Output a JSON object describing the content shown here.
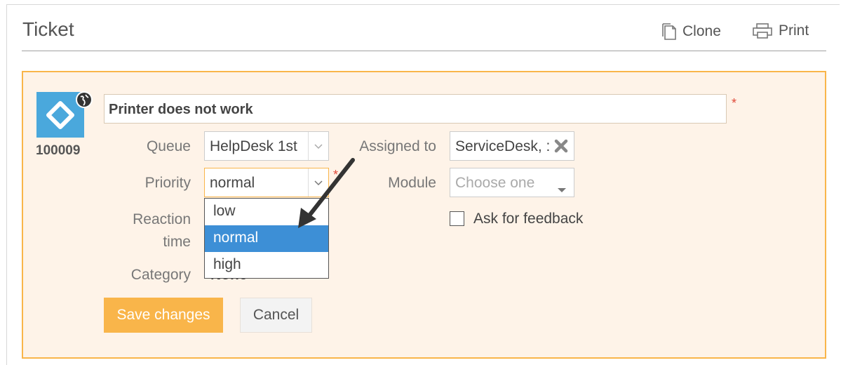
{
  "header": {
    "title": "Ticket",
    "clone_label": "Clone",
    "print_label": "Print"
  },
  "ticket": {
    "id": "100009",
    "subject": "Printer does not work"
  },
  "fields": {
    "queue_label": "Queue",
    "queue_value": "HelpDesk 1st",
    "assigned_label": "Assigned to",
    "assigned_value": "ServiceDesk, :",
    "priority_label": "Priority",
    "priority_value": "normal",
    "module_label": "Module",
    "module_placeholder": "Choose one",
    "reaction_label_1": "Reaction",
    "reaction_label_2": "time",
    "category_label": "Category",
    "category_value": "None",
    "feedback_label": "Ask for feedback",
    "required_mark": "*"
  },
  "priority_options": [
    "low",
    "normal",
    "high"
  ],
  "buttons": {
    "save_label": "Save changes",
    "cancel_label": "Cancel"
  },
  "colors": {
    "accent": "#f9b54a",
    "panel_bg": "#fef3e8",
    "selected": "#3d8fd6",
    "logo": "#4aa8dc"
  }
}
